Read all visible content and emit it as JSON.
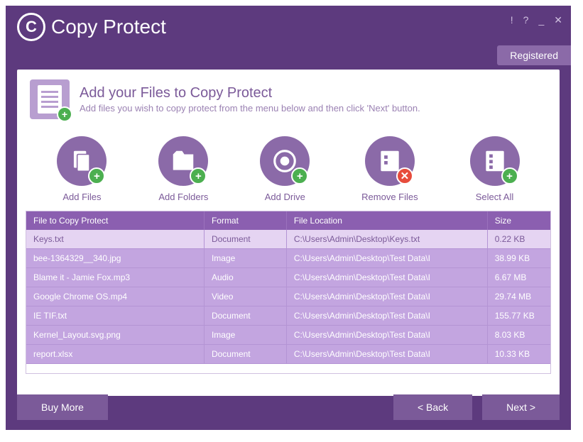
{
  "app": {
    "name": "Copy Protect"
  },
  "status": {
    "registered": "Registered"
  },
  "header": {
    "title": "Add your Files to Copy Protect",
    "subtitle": "Add files you wish to copy protect from the menu below and then click 'Next' button."
  },
  "actions": {
    "addFiles": "Add Files",
    "addFolders": "Add Folders",
    "addDrive": "Add Drive",
    "removeFiles": "Remove Files",
    "selectAll": "Select All"
  },
  "table": {
    "headers": {
      "file": "File to Copy Protect",
      "format": "Format",
      "location": "File Location",
      "size": "Size"
    },
    "rows": [
      {
        "file": "Keys.txt",
        "format": "Document",
        "location": "C:\\Users\\Admin\\Desktop\\Keys.txt",
        "size": "0.22 KB"
      },
      {
        "file": "bee-1364329__340.jpg",
        "format": "Image",
        "location": "C:\\Users\\Admin\\Desktop\\Test Data\\I",
        "size": "38.99 KB"
      },
      {
        "file": "Blame it - Jamie Fox.mp3",
        "format": "Audio",
        "location": "C:\\Users\\Admin\\Desktop\\Test Data\\I",
        "size": "6.67 MB"
      },
      {
        "file": "Google Chrome OS.mp4",
        "format": "Video",
        "location": "C:\\Users\\Admin\\Desktop\\Test Data\\I",
        "size": "29.74 MB"
      },
      {
        "file": "IE TIF.txt",
        "format": "Document",
        "location": "C:\\Users\\Admin\\Desktop\\Test Data\\I",
        "size": "155.77 KB"
      },
      {
        "file": "Kernel_Layout.svg.png",
        "format": "Image",
        "location": "C:\\Users\\Admin\\Desktop\\Test Data\\I",
        "size": "8.03 KB"
      },
      {
        "file": "report.xlsx",
        "format": "Document",
        "location": "C:\\Users\\Admin\\Desktop\\Test Data\\I",
        "size": "10.33 KB"
      }
    ]
  },
  "footer": {
    "buyMore": "Buy More",
    "back": "< Back",
    "next": "Next >"
  }
}
